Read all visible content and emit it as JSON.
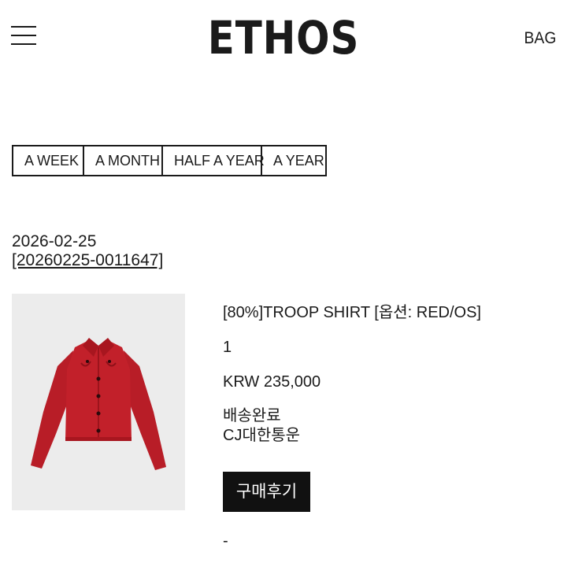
{
  "header": {
    "logo": "ETHOS",
    "bag_label": "BAG"
  },
  "period_filter": [
    {
      "label": "A WEEK"
    },
    {
      "label": "A MONTH"
    },
    {
      "label": "HALF A YEAR"
    },
    {
      "label": "A YEAR"
    }
  ],
  "order": {
    "date": "2026-02-25",
    "number": "[20260225-0011647]",
    "item": {
      "name": "[80%]TROOP SHIRT [옵션: RED/OS]",
      "quantity": "1",
      "price": "KRW 235,000",
      "status": "배송완료",
      "carrier": "CJ대한통운",
      "review_button": "구매후기",
      "extra": "-",
      "image_color": "#c2202a",
      "image_bg": "#ececec"
    }
  }
}
